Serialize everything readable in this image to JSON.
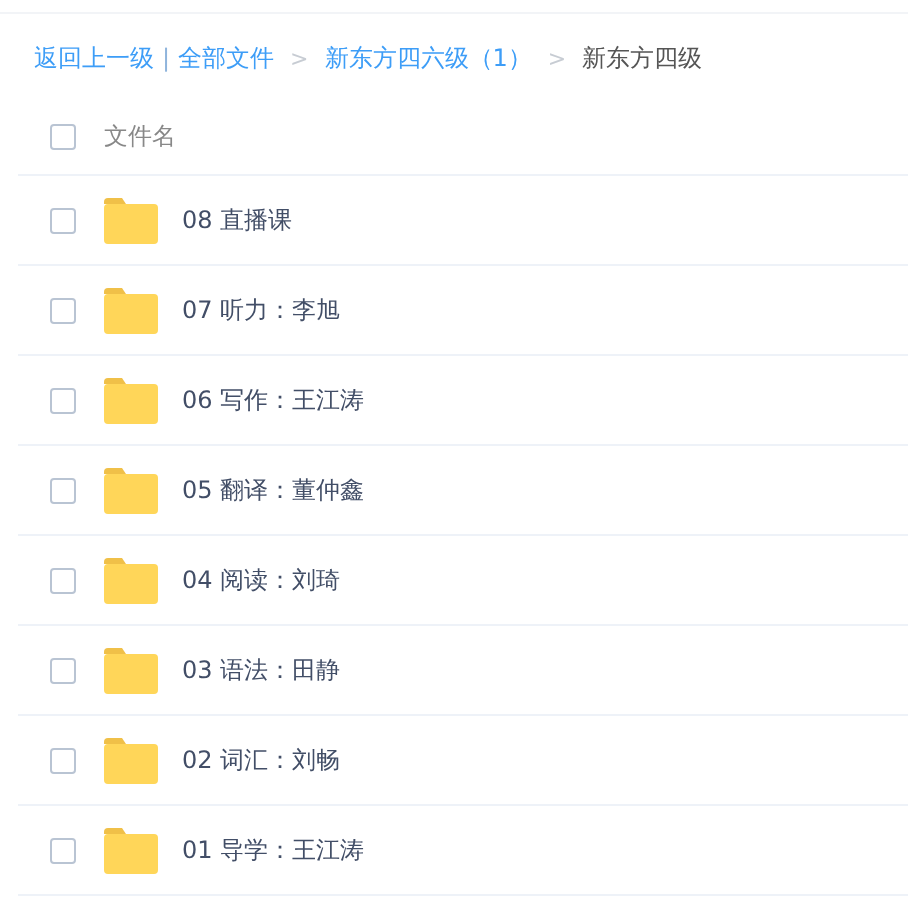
{
  "breadcrumb": [
    {
      "kind": "link",
      "label": "返回上一级"
    },
    {
      "kind": "divider",
      "label": "|"
    },
    {
      "kind": "link",
      "label": "全部文件"
    },
    {
      "kind": "separator",
      "label": ">"
    },
    {
      "kind": "link",
      "label": "新东方四六级（1）"
    },
    {
      "kind": "separator",
      "label": ">"
    },
    {
      "kind": "current",
      "label": "新东方四级"
    }
  ],
  "header": {
    "checked": false,
    "label": "文件名"
  },
  "files": [
    {
      "name": "08 直播课",
      "checked": false
    },
    {
      "name": "07 听力：李旭",
      "checked": false
    },
    {
      "name": "06 写作：王江涛",
      "checked": false
    },
    {
      "name": "05 翻译：董仲鑫",
      "checked": false
    },
    {
      "name": "04 阅读：刘琦",
      "checked": false
    },
    {
      "name": "03 语法：田静",
      "checked": false
    },
    {
      "name": "02 词汇：刘畅",
      "checked": false
    },
    {
      "name": "01 导学：王江涛",
      "checked": false
    }
  ]
}
